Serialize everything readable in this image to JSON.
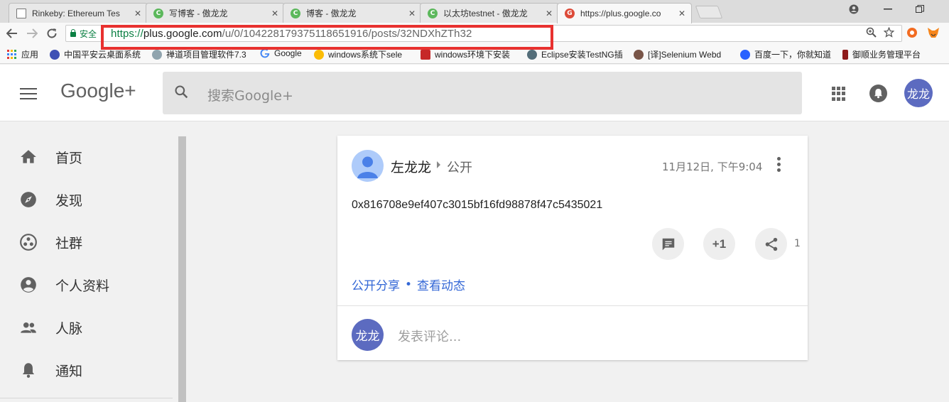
{
  "browser": {
    "tabs": [
      {
        "title": "Rinkeby: Ethereum Tes",
        "close": "✕"
      },
      {
        "title": "写博客 - 傲龙龙",
        "close": "✕"
      },
      {
        "title": "博客 - 傲龙龙",
        "close": "✕"
      },
      {
        "title": "以太坊testnet - 傲龙龙",
        "close": "✕"
      },
      {
        "title": "https://plus.google.co",
        "close": "✕"
      }
    ],
    "secure_label": "安全",
    "url_scheme": "https://",
    "url_domain": "plus.google.com",
    "url_path": "/u/0/104228179375118651916/posts/32NDXhZTh32",
    "bookmarks": [
      {
        "label": "应用",
        "color": "#4285f4"
      },
      {
        "label": "中国平安云桌面系统",
        "color": "#3f51b5"
      },
      {
        "label": "禅道项目管理软件7.3",
        "color": "#90a4ae"
      },
      {
        "label": "Google",
        "color": "#34a853"
      },
      {
        "label": "windows系统下sele",
        "color": "#fbbc05"
      },
      {
        "label": "windows环境下安装",
        "color": "#c62828"
      },
      {
        "label": "Eclipse安装TestNG插",
        "color": "#546e7a"
      },
      {
        "label": "[译]Selenium Webd",
        "color": "#795548"
      },
      {
        "label": "百度一下，你就知道",
        "color": "#2962ff"
      },
      {
        "label": "御顺业务管理平台",
        "color": "#8e1b1b"
      }
    ]
  },
  "header": {
    "logo": "Google+",
    "search_placeholder": "搜索Google+",
    "avatar_text": "龙龙"
  },
  "sidebar": {
    "items": [
      {
        "label": "首页",
        "icon": "home-icon"
      },
      {
        "label": "发现",
        "icon": "compass-icon"
      },
      {
        "label": "社群",
        "icon": "communities-icon"
      },
      {
        "label": "个人资料",
        "icon": "profile-icon"
      },
      {
        "label": "人脉",
        "icon": "people-icon"
      },
      {
        "label": "通知",
        "icon": "bell-icon"
      }
    ]
  },
  "post": {
    "author": "左龙龙",
    "visibility": "公开",
    "timestamp": "11月12日, 下午9:04",
    "content": "0x816708e9ef407c3015bf16fd98878f47c5435021",
    "plusone_label": "+1",
    "share_count": "1",
    "share_public": "公开分享",
    "separator": "•",
    "view_activity": "查看动态",
    "comment_avatar_text": "龙龙",
    "comment_placeholder": "发表评论..."
  },
  "colors": {
    "accent_link": "#3367d6",
    "avatar": "#5c6bc0",
    "secure_green": "#0b8043",
    "highlight_box": "#e8312f"
  }
}
